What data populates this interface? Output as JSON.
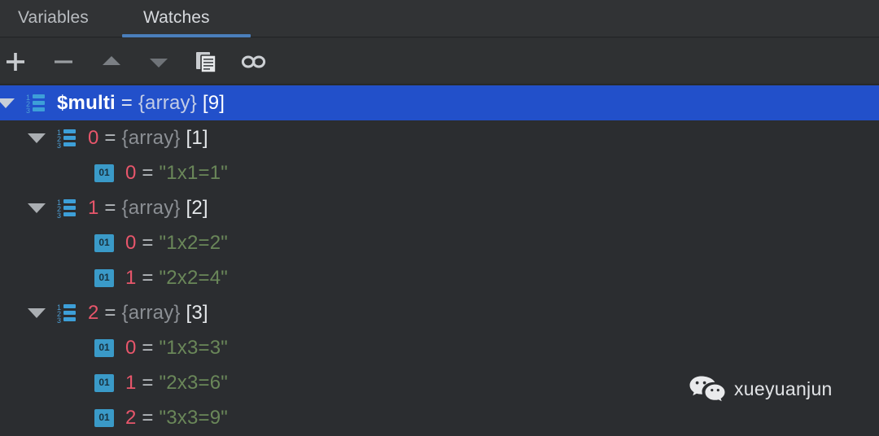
{
  "panel": {
    "tabs": [
      {
        "label": "Variables",
        "active": false
      },
      {
        "label": "Watches",
        "active": true
      }
    ],
    "accent_color": "#4a7ebb",
    "selection_color": "#2250ca",
    "background_color": "#2b2d30"
  },
  "toolbar": {
    "buttons": [
      {
        "name": "add-watch",
        "icon": "plus-icon",
        "label": "+"
      },
      {
        "name": "remove-watch",
        "icon": "minus-icon",
        "label": "−"
      },
      {
        "name": "move-up",
        "icon": "triangle-up-icon",
        "label": "▲"
      },
      {
        "name": "move-down",
        "icon": "triangle-down-icon",
        "label": "▼"
      },
      {
        "name": "copy-value",
        "icon": "copy-icon",
        "label": "Copy"
      },
      {
        "name": "watch-expression",
        "icon": "glasses-icon",
        "label": "Watch"
      }
    ]
  },
  "tree": {
    "rows": [
      {
        "depth": 0,
        "selected": true,
        "expanded": true,
        "icon": "array-icon",
        "key": "$multi",
        "equals": "=",
        "type": "{array}",
        "count": "[9]"
      },
      {
        "depth": 1,
        "selected": false,
        "expanded": true,
        "icon": "array-icon",
        "key": "0",
        "equals": "=",
        "type": "{array}",
        "count": "[1]"
      },
      {
        "depth": 2,
        "selected": false,
        "expanded": null,
        "icon": "string-icon",
        "key": "0",
        "equals": "=",
        "value": "\"1x1=1\""
      },
      {
        "depth": 1,
        "selected": false,
        "expanded": true,
        "icon": "array-icon",
        "key": "1",
        "equals": "=",
        "type": "{array}",
        "count": "[2]"
      },
      {
        "depth": 2,
        "selected": false,
        "expanded": null,
        "icon": "string-icon",
        "key": "0",
        "equals": "=",
        "value": "\"1x2=2\""
      },
      {
        "depth": 2,
        "selected": false,
        "expanded": null,
        "icon": "string-icon",
        "key": "1",
        "equals": "=",
        "value": "\"2x2=4\""
      },
      {
        "depth": 1,
        "selected": false,
        "expanded": true,
        "icon": "array-icon",
        "key": "2",
        "equals": "=",
        "type": "{array}",
        "count": "[3]"
      },
      {
        "depth": 2,
        "selected": false,
        "expanded": null,
        "icon": "string-icon",
        "key": "0",
        "equals": "=",
        "value": "\"1x3=3\""
      },
      {
        "depth": 2,
        "selected": false,
        "expanded": null,
        "icon": "string-icon",
        "key": "1",
        "equals": "=",
        "value": "\"2x3=6\""
      },
      {
        "depth": 2,
        "selected": false,
        "expanded": null,
        "icon": "string-icon",
        "key": "2",
        "equals": "=",
        "value": "\"3x3=9\""
      }
    ]
  },
  "watermark": {
    "icon": "wechat-icon",
    "text": "xueyuanjun"
  }
}
